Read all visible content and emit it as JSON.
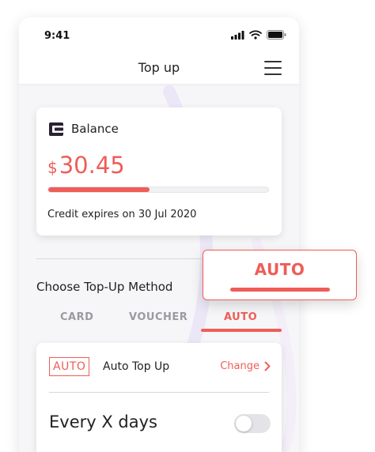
{
  "status_bar": {
    "time": "9:41"
  },
  "header": {
    "title": "Top up",
    "menu_icon": "hamburger-menu-icon"
  },
  "balance": {
    "icon": "wallet-icon",
    "label": "Balance",
    "currency": "$",
    "amount": "30.45",
    "progress_fraction": 0.46,
    "expiry_text": "Credit expires on 30 Jul 2020"
  },
  "method": {
    "title": "Choose Top-Up Method",
    "tabs": [
      {
        "label": "CARD",
        "active": false
      },
      {
        "label": "VOUCHER",
        "active": false
      },
      {
        "label": "AUTO",
        "active": true
      }
    ]
  },
  "method_card": {
    "badge": "AUTO",
    "label": "Auto Top Up",
    "change_label": "Change",
    "change_icon": "chevron-right-icon",
    "option_label": "Every X days",
    "toggle_on": false
  },
  "callout": {
    "label": "AUTO"
  },
  "colors": {
    "accent": "#ef5d58",
    "text": "#222222",
    "muted": "#9a9aa0",
    "background": "#f6f6f8"
  }
}
